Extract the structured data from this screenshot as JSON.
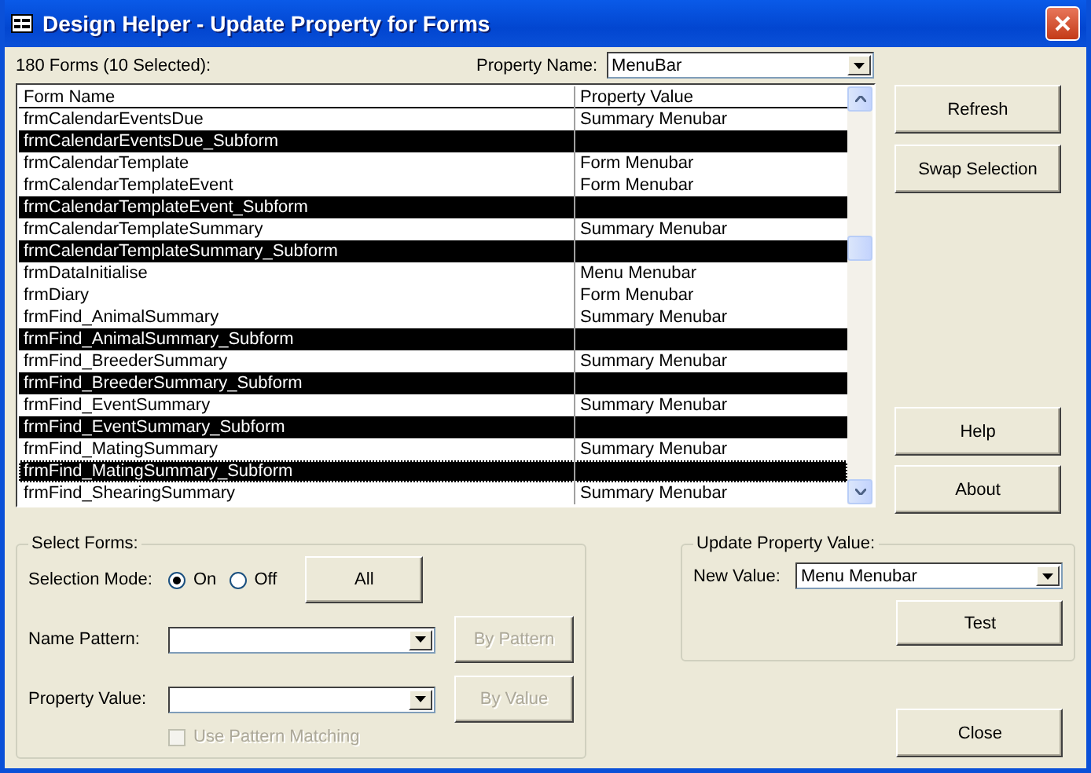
{
  "window": {
    "title": "Design Helper - Update Property for Forms"
  },
  "summary": "180 Forms (10 Selected):",
  "property_name": {
    "label": "Property Name:",
    "value": "MenuBar"
  },
  "table": {
    "columns": [
      "Form Name",
      "Property Value"
    ],
    "rows": [
      {
        "name": "frmCalendarEventsDue",
        "value": "Summary Menubar",
        "selected": false,
        "focused": false
      },
      {
        "name": "frmCalendarEventsDue_Subform",
        "value": "",
        "selected": true,
        "focused": false
      },
      {
        "name": "frmCalendarTemplate",
        "value": "Form Menubar",
        "selected": false,
        "focused": false
      },
      {
        "name": "frmCalendarTemplateEvent",
        "value": "Form Menubar",
        "selected": false,
        "focused": false
      },
      {
        "name": "frmCalendarTemplateEvent_Subform",
        "value": "",
        "selected": true,
        "focused": false
      },
      {
        "name": "frmCalendarTemplateSummary",
        "value": "Summary Menubar",
        "selected": false,
        "focused": false
      },
      {
        "name": "frmCalendarTemplateSummary_Subform",
        "value": "",
        "selected": true,
        "focused": false
      },
      {
        "name": "frmDataInitialise",
        "value": "Menu Menubar",
        "selected": false,
        "focused": false
      },
      {
        "name": "frmDiary",
        "value": "Form Menubar",
        "selected": false,
        "focused": false
      },
      {
        "name": "frmFind_AnimalSummary",
        "value": "Summary Menubar",
        "selected": false,
        "focused": false
      },
      {
        "name": "frmFind_AnimalSummary_Subform",
        "value": "",
        "selected": true,
        "focused": false
      },
      {
        "name": "frmFind_BreederSummary",
        "value": "Summary Menubar",
        "selected": false,
        "focused": false
      },
      {
        "name": "frmFind_BreederSummary_Subform",
        "value": "",
        "selected": true,
        "focused": false
      },
      {
        "name": "frmFind_EventSummary",
        "value": "Summary Menubar",
        "selected": false,
        "focused": false
      },
      {
        "name": "frmFind_EventSummary_Subform",
        "value": "",
        "selected": true,
        "focused": false
      },
      {
        "name": "frmFind_MatingSummary",
        "value": "Summary Menubar",
        "selected": false,
        "focused": false
      },
      {
        "name": "frmFind_MatingSummary_Subform",
        "value": "",
        "selected": true,
        "focused": true
      },
      {
        "name": "frmFind_ShearingSummary",
        "value": "Summary Menubar",
        "selected": false,
        "focused": false
      }
    ]
  },
  "top_buttons": [
    "Refresh",
    "Swap Selection"
  ],
  "info_buttons": [
    "Help",
    "About"
  ],
  "select_forms": {
    "title": "Select Forms:",
    "mode_label": "Selection Mode:",
    "modes": [
      {
        "label": "On",
        "selected": true
      },
      {
        "label": "Off",
        "selected": false
      }
    ],
    "all_button": "All",
    "filters": [
      {
        "label": "Name Pattern:",
        "button": "By Pattern",
        "disabled": true
      },
      {
        "label": "Property Value:",
        "button": "By Value",
        "disabled": true
      }
    ],
    "pattern_matching": {
      "label": "Use Pattern Matching",
      "checked": false,
      "disabled": true
    }
  },
  "update": {
    "title": "Update Property Value:",
    "label": "New Value:",
    "value": "Menu Menubar",
    "button": "Test"
  },
  "close_button": "Close"
}
